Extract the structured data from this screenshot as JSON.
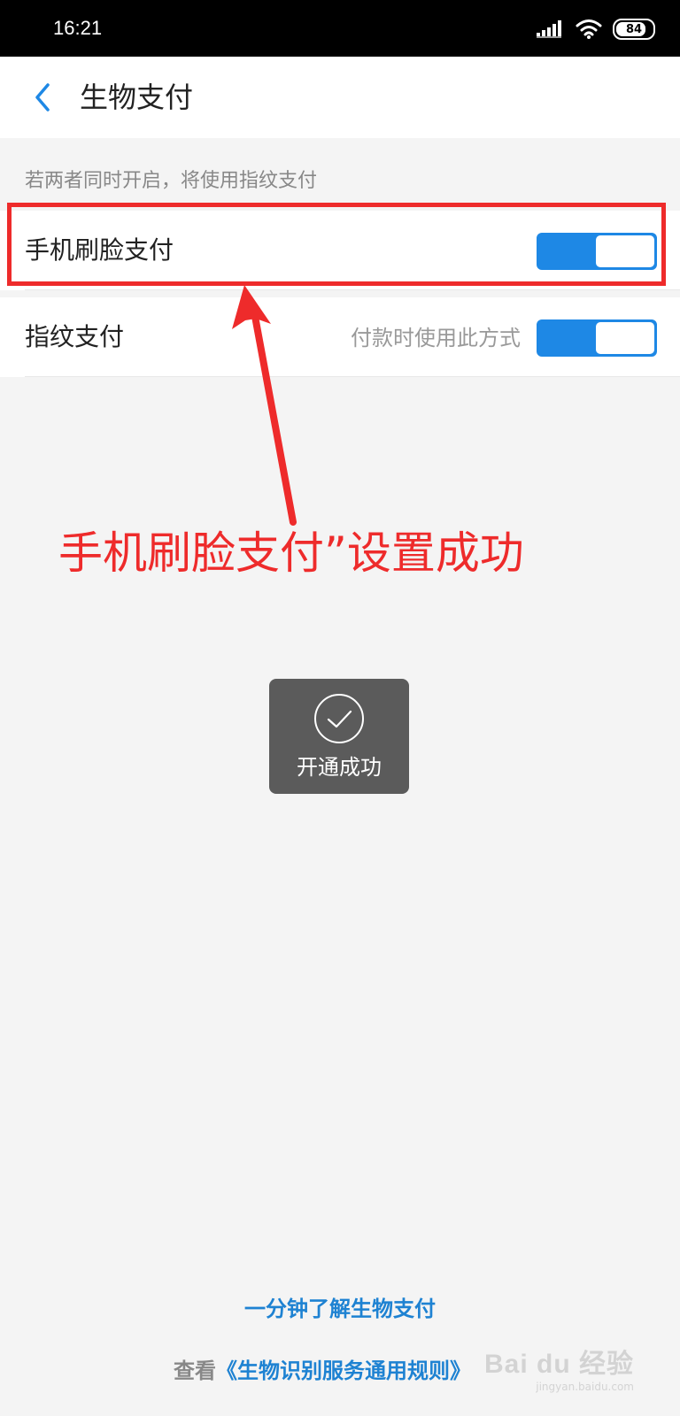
{
  "status_bar": {
    "time": "16:21",
    "battery": "84",
    "battery_level": 0.84,
    "icons": [
      "signal-icon",
      "wifi-icon",
      "battery-icon"
    ]
  },
  "header": {
    "back_icon": "chevron-left-icon",
    "title": "生物支付"
  },
  "hint": "若两者同时开启，将使用指纹支付",
  "rows": [
    {
      "label": "手机刷脸支付",
      "hint": "",
      "enabled": true
    },
    {
      "label": "指纹支付",
      "hint": "付款时使用此方式",
      "enabled": true
    }
  ],
  "annotation": "手机刷脸支付”设置成功",
  "toast": {
    "icon": "check-circle-icon",
    "text": "开通成功"
  },
  "footer": {
    "learn_link": "一分钟了解生物支付",
    "rules_prefix": "查看",
    "rules_link": "《生物识别服务通用规则》"
  },
  "watermark": {
    "main": "Bai du 经验",
    "sub": "jingyan.baidu.com"
  },
  "colors": {
    "accent": "#1e88e5",
    "link": "#1e82d2",
    "annotation": "#ee2b2b",
    "toast_bg": "#5b5b5b"
  }
}
